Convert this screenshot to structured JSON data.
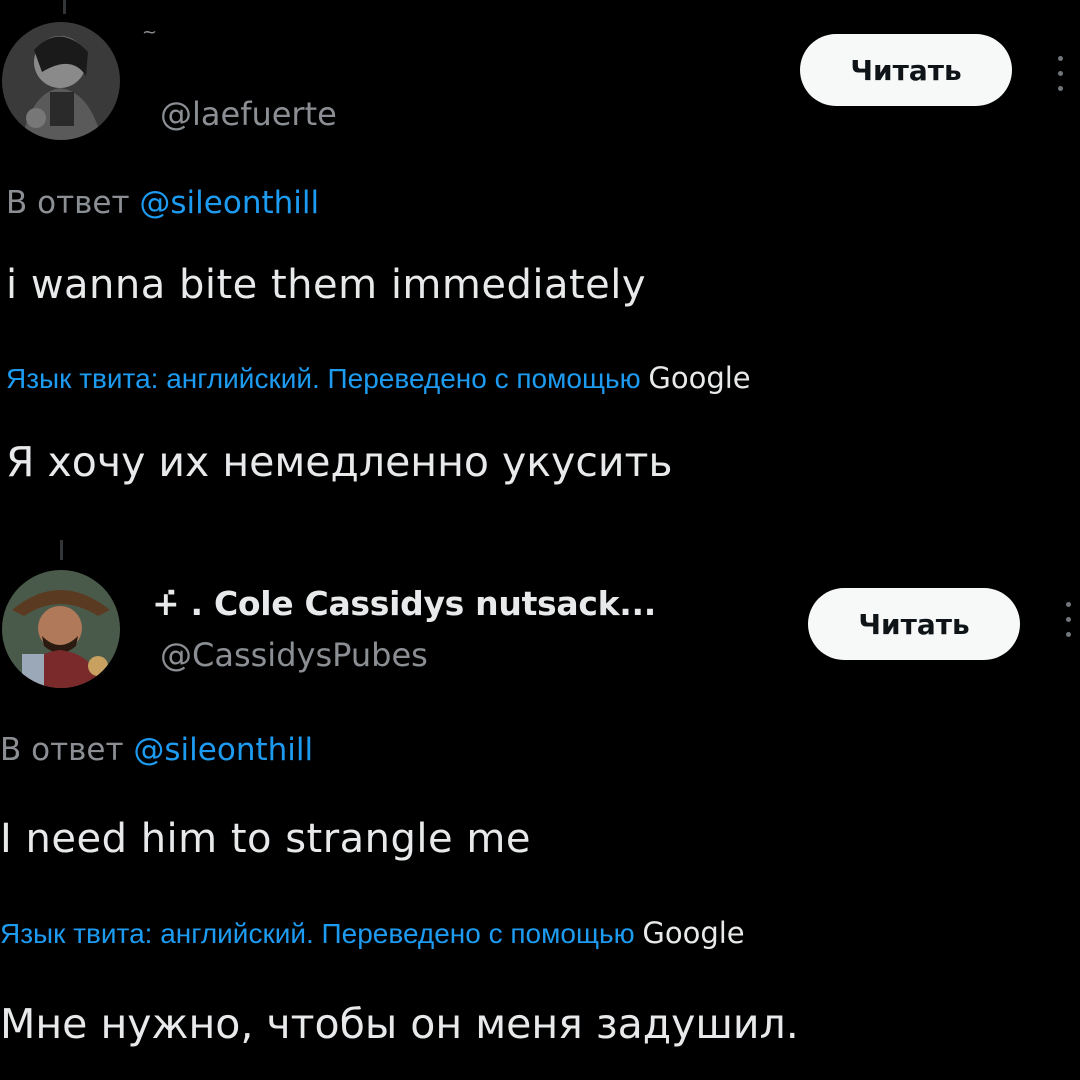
{
  "tweets": [
    {
      "display_name": "",
      "name_glyph": "~",
      "handle": "@laefuerte",
      "follow_label": "Читать",
      "reply_prefix": "В ответ",
      "reply_mention": "@sileonthill",
      "text": "i wanna bite them immediately",
      "translate_note": "Язык твита: английский. Переведено с помощью",
      "translate_brand": "Google",
      "translation": "Я хочу их немедленно укусить"
    },
    {
      "display_name": "+̇ . Cole Cassidys nutsack...",
      "handle": "@CassidysPubes",
      "follow_label": "Читать",
      "reply_prefix": "В ответ",
      "reply_mention": "@sileonthill",
      "text": "I need him to strangle me",
      "translate_note": "Язык твита: английский. Переведено с помощью",
      "translate_brand": "Google",
      "translation": "Мне нужно, чтобы он меня задушил."
    }
  ],
  "colors": {
    "background": "#000000",
    "text": "#e7e9ea",
    "muted": "#8b8f94",
    "accent": "#1d9bf0",
    "button_bg": "#f7f9f9"
  },
  "icons": {
    "more": "more-vertical-icon",
    "avatar": "avatar-image"
  }
}
